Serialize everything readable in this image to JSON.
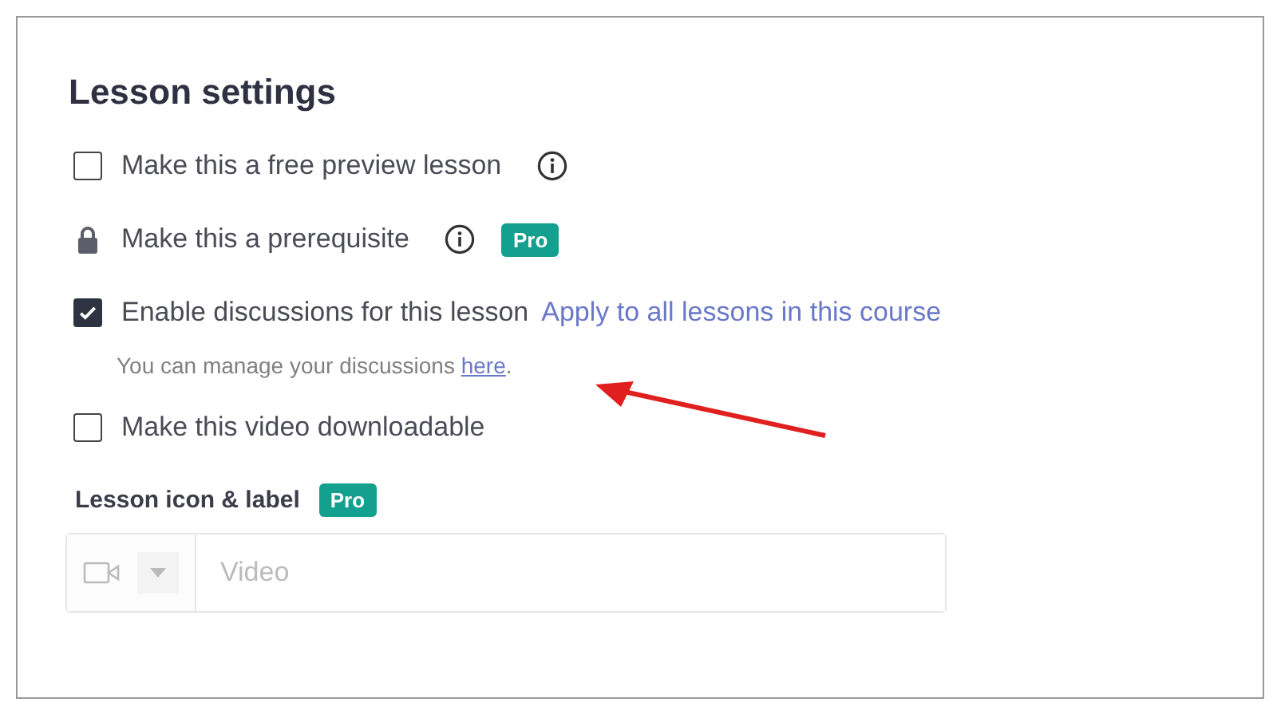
{
  "title": "Lesson settings",
  "options": [
    {
      "kind": "checkbox",
      "label": "Make this a free preview lesson",
      "checked": false,
      "info": true
    },
    {
      "kind": "locked",
      "label": "Make this a prerequisite",
      "info": true,
      "pro": "Pro"
    },
    {
      "kind": "checkbox",
      "label": "Enable discussions for this lesson",
      "checked": true,
      "info": false,
      "link": "Apply to all lessons in this course",
      "note": {
        "before": "You can manage your discussions ",
        "link": "here",
        "after": "."
      }
    },
    {
      "kind": "checkbox",
      "label": "Make this video downloadable",
      "checked": false,
      "info": false
    }
  ],
  "icon_label": {
    "label": "Lesson icon & label",
    "badge": "Pro",
    "placeholder": "Video",
    "disabled": true
  }
}
